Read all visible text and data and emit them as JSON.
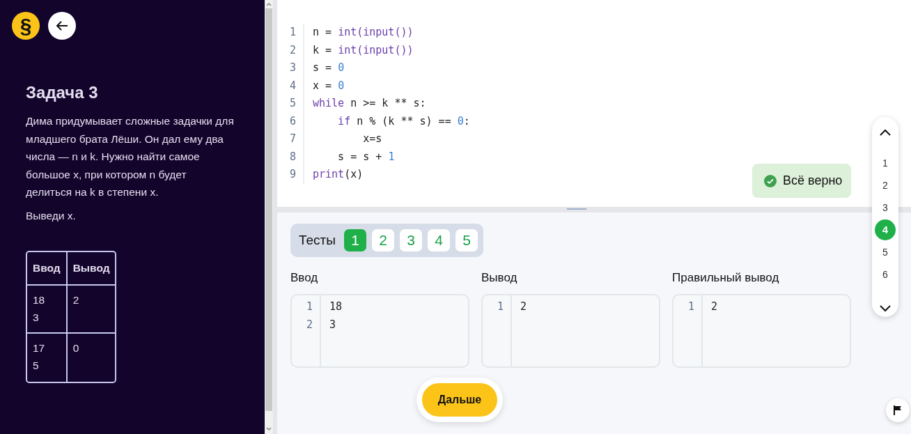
{
  "sidebar": {
    "logo_symbol": "§",
    "title": "Задача 3",
    "paragraphs": [
      "Дима придумывает сложные задачки для младшего брата Лёши. Он дал ему два числа — n и k. Нужно найти самое большое x, при котором n будет делиться на k в степени x.",
      "Выведи x."
    ],
    "examples_table": {
      "columns": [
        "Ввод",
        "Вывод"
      ],
      "rows": [
        [
          "18\n3",
          "2"
        ],
        [
          "17\n5",
          "0"
        ]
      ]
    }
  },
  "editor": {
    "lines": [
      {
        "number": "1",
        "tokens": [
          {
            "kind": "plain",
            "text": "n = "
          },
          {
            "kind": "keyword",
            "text": "int(input())"
          }
        ]
      },
      {
        "number": "2",
        "tokens": [
          {
            "kind": "plain",
            "text": "k = "
          },
          {
            "kind": "keyword",
            "text": "int(input())"
          }
        ]
      },
      {
        "number": "3",
        "tokens": [
          {
            "kind": "plain",
            "text": "s = "
          },
          {
            "kind": "number",
            "text": "0"
          }
        ]
      },
      {
        "number": "4",
        "tokens": [
          {
            "kind": "plain",
            "text": "x = "
          },
          {
            "kind": "number",
            "text": "0"
          }
        ]
      },
      {
        "number": "5",
        "tokens": [
          {
            "kind": "keyword",
            "text": "while"
          },
          {
            "kind": "plain",
            "text": " n >= k ** s:"
          }
        ]
      },
      {
        "number": "6",
        "tokens": [
          {
            "kind": "keyword",
            "text": "    if"
          },
          {
            "kind": "plain",
            "text": " n % (k ** s) == "
          },
          {
            "kind": "number",
            "text": "0"
          },
          {
            "kind": "plain",
            "text": ":"
          }
        ]
      },
      {
        "number": "7",
        "tokens": [
          {
            "kind": "plain",
            "text": "        x=s"
          }
        ]
      },
      {
        "number": "8",
        "tokens": [
          {
            "kind": "plain",
            "text": "    s = s + "
          },
          {
            "kind": "number",
            "text": "1"
          }
        ]
      },
      {
        "number": "9",
        "tokens": [
          {
            "kind": "keyword",
            "text": "print"
          },
          {
            "kind": "plain",
            "text": "(x)"
          }
        ]
      }
    ]
  },
  "toast": {
    "text": "Всё верно"
  },
  "tests": {
    "label": "Тесты",
    "items": [
      {
        "label": "1",
        "selected": true
      },
      {
        "label": "2",
        "selected": false
      },
      {
        "label": "3",
        "selected": false
      },
      {
        "label": "4",
        "selected": false
      },
      {
        "label": "5",
        "selected": false
      }
    ]
  },
  "panels": [
    {
      "title": "Ввод",
      "lines": [
        {
          "number": "1",
          "text": "18"
        },
        {
          "number": "2",
          "text": "3"
        }
      ]
    },
    {
      "title": "Вывод",
      "lines": [
        {
          "number": "1",
          "text": "2"
        }
      ]
    },
    {
      "title": "Правильный вывод",
      "lines": [
        {
          "number": "1",
          "text": "2"
        }
      ]
    }
  ],
  "next_button": "Дальше",
  "task_nav": {
    "items": [
      {
        "label": "1",
        "selected": false
      },
      {
        "label": "2",
        "selected": false
      },
      {
        "label": "3",
        "selected": false
      },
      {
        "label": "4",
        "selected": true
      },
      {
        "label": "5",
        "selected": false
      },
      {
        "label": "6",
        "selected": false
      }
    ]
  }
}
